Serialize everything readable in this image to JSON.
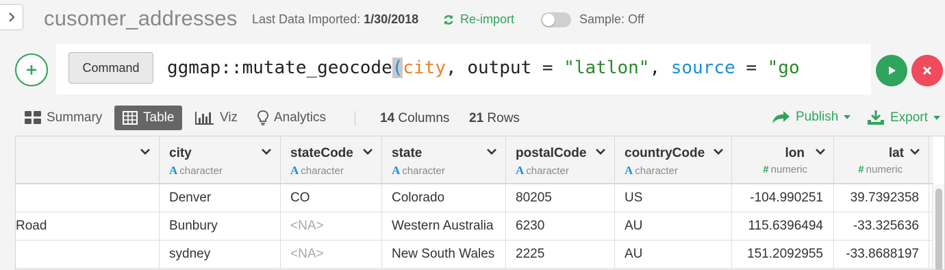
{
  "header": {
    "title": "cusomer_addresses",
    "last_import_label": "Last Data Imported:",
    "last_import_date": "1/30/2018",
    "reimport_label": "Re-import",
    "sample_label": "Sample: Off"
  },
  "command": {
    "type_button": "Command",
    "text_prefix": "ggmap::mutate_geocode",
    "paren": "(",
    "arg1": "city",
    "sep1": ", output = ",
    "str1": "\"latlon\"",
    "sep2": ", ",
    "kw1": "source",
    "sep3": " = ",
    "str2": "\"go"
  },
  "views": {
    "summary": "Summary",
    "table": "Table",
    "viz": "Viz",
    "analytics": "Analytics",
    "columns_count": "14",
    "columns_label": "Columns",
    "rows_count": "21",
    "rows_label": "Rows",
    "publish": "Publish",
    "export": "Export"
  },
  "table": {
    "columns": [
      {
        "name": "",
        "type": ""
      },
      {
        "name": "city",
        "type": "character",
        "icon": "A"
      },
      {
        "name": "stateCode",
        "type": "character",
        "icon": "A"
      },
      {
        "name": "state",
        "type": "character",
        "icon": "A"
      },
      {
        "name": "postalCode",
        "type": "character",
        "icon": "A"
      },
      {
        "name": "countryCode",
        "type": "character",
        "icon": "A"
      },
      {
        "name": "lon",
        "type": "numeric",
        "icon": "#"
      },
      {
        "name": "lat",
        "type": "numeric",
        "icon": "#"
      }
    ],
    "rows": [
      [
        "",
        "Denver",
        "CO",
        "Colorado",
        "80205",
        "US",
        "-104.990251",
        "39.7392358"
      ],
      [
        "Road",
        "Bunbury",
        "<NA>",
        "Western Australia",
        "6230",
        "AU",
        "115.6396494",
        "-33.325636"
      ],
      [
        "",
        "sydney",
        "<NA>",
        "New South Wales",
        "2225",
        "AU",
        "151.2092955",
        "-33.8688197"
      ]
    ]
  },
  "colors": {
    "accent_green": "#2fa45c",
    "cancel_red": "#ef4b5c",
    "character_blue": "#1a8fd8"
  }
}
